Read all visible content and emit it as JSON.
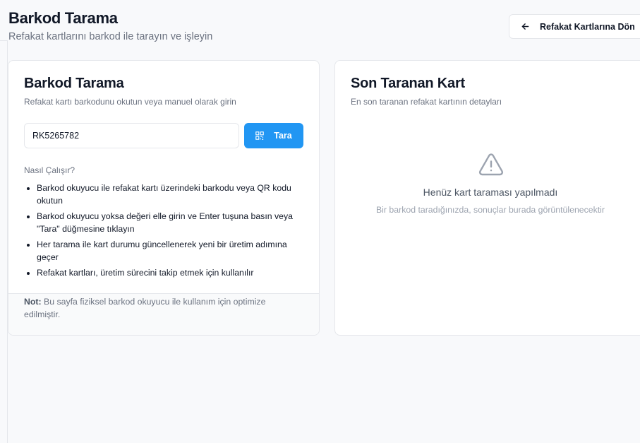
{
  "header": {
    "title": "Barkod Tarama",
    "subtitle": "Refakat kartlarını barkod ile tarayın ve işleyin",
    "back_button_label": "Refakat Kartlarına Dön",
    "back_icon": "arrow-left-icon"
  },
  "scan_card": {
    "title": "Barkod Tarama",
    "description": "Refakat kartı barkodunu okutun veya manuel olarak girin",
    "input_value": "RK5265782",
    "scan_button_label": "Tara",
    "scan_button_icon": "qr-code-icon",
    "how_title": "Nasıl Çalışır?",
    "how_items": [
      "Barkod okuyucu ile refakat kartı üzerindeki barkodu veya QR kodu okutun",
      "Barkod okuyucu yoksa değeri elle girin ve Enter tuşuna basın veya \"Tara\" düğmesine tıklayın",
      "Her tarama ile kart durumu güncellenerek yeni bir üretim adımına geçer",
      "Refakat kartları, üretim sürecini takip etmek için kullanılır"
    ],
    "note_label": "Not:",
    "note_text": " Bu sayfa fiziksel barkod okuyucu ile kullanım için optimize edilmiştir."
  },
  "last_card": {
    "title": "Son Taranan Kart",
    "description": "En son taranan refakat kartının detayları",
    "empty_icon": "warning-triangle-icon",
    "empty_title": "Henüz kart taraması yapılmadı",
    "empty_description": "Bir barkod taradığınızda, sonuçlar burada görüntülenecektir"
  },
  "colors": {
    "primary": "#2196f3",
    "background": "#f8f9fb",
    "border": "#e5e7eb"
  }
}
